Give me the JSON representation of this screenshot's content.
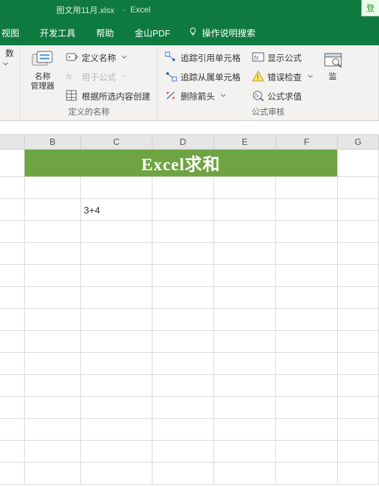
{
  "title": {
    "file": "图文用11月.xlsx",
    "sep": "-",
    "app": "Excel"
  },
  "tabs": {
    "view": "视图",
    "dev": "开发工具",
    "help": "帮助",
    "pdf": "金山PDF",
    "tellme": "操作说明搜索"
  },
  "ribbon": {
    "preGroupLabel": "数",
    "names": {
      "title": "名称\n管理器",
      "define": "定义名称",
      "useFormula": "用于公式",
      "createFrom": "根据所选内容创建",
      "groupLabel": "定义的名称"
    },
    "audit": {
      "tracePrec": "追踪引用单元格",
      "traceDep": "追踪从属单元格",
      "removeArrow": "删除箭头",
      "showFormula": "显示公式",
      "errorCheck": "错误检查",
      "evaluate": "公式求值",
      "watch": "监",
      "groupLabel": "公式审核"
    }
  },
  "topRight": "登",
  "columns": [
    "B",
    "C",
    "D",
    "E",
    "F",
    "G"
  ],
  "colWidths": {
    "first": 36,
    "B": 82,
    "C": 104,
    "D": 90,
    "E": 90,
    "F": 90,
    "G": 60
  },
  "mergedTitle": "Excel求和",
  "cellValue": "3+4",
  "formulaBar": ""
}
